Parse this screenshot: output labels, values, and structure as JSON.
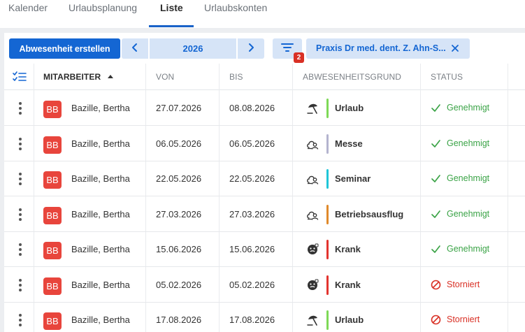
{
  "tabs": [
    {
      "label": "Kalender",
      "active": false
    },
    {
      "label": "Urlaubsplanung",
      "active": false
    },
    {
      "label": "Liste",
      "active": true
    },
    {
      "label": "Urlaubskonten",
      "active": false
    }
  ],
  "toolbar": {
    "create_label": "Abwesenheit erstellen",
    "year": "2026",
    "filter_count": "2",
    "chip_label": "Praxis Dr med. dent. Z. Ahn-S..."
  },
  "table": {
    "headers": {
      "employee": "MITARBEITER",
      "from": "VON",
      "to": "BIS",
      "reason": "ABWESENHEITSGRUND",
      "status": "STATUS"
    },
    "rows": [
      {
        "initials": "BB",
        "name": "Bazille, Bertha",
        "from": "27.07.2026",
        "to": "08.08.2026",
        "reason": "Urlaub",
        "reason_icon": "beach-umbrella-icon",
        "reason_color": "#7ed957",
        "status": "Genehmigt",
        "status_type": "approved"
      },
      {
        "initials": "BB",
        "name": "Bazille, Bertha",
        "from": "06.05.2026",
        "to": "06.05.2026",
        "reason": "Messe",
        "reason_icon": "cloud-person-icon",
        "reason_color": "#b4b4cf",
        "status": "Genehmigt",
        "status_type": "approved"
      },
      {
        "initials": "BB",
        "name": "Bazille, Bertha",
        "from": "22.05.2026",
        "to": "22.05.2026",
        "reason": "Seminar",
        "reason_icon": "cloud-person-icon",
        "reason_color": "#1fc6d8",
        "status": "Genehmigt",
        "status_type": "approved"
      },
      {
        "initials": "BB",
        "name": "Bazille, Bertha",
        "from": "27.03.2026",
        "to": "27.03.2026",
        "reason": "Betriebsausflug",
        "reason_icon": "cloud-person-icon",
        "reason_color": "#e08a2b",
        "status": "Genehmigt",
        "status_type": "approved"
      },
      {
        "initials": "BB",
        "name": "Bazille, Bertha",
        "from": "15.06.2026",
        "to": "15.06.2026",
        "reason": "Krank",
        "reason_icon": "sick-face-icon",
        "reason_color": "#e3342f",
        "status": "Genehmigt",
        "status_type": "approved"
      },
      {
        "initials": "BB",
        "name": "Bazille, Bertha",
        "from": "05.02.2026",
        "to": "05.02.2026",
        "reason": "Krank",
        "reason_icon": "sick-face-icon",
        "reason_color": "#e3342f",
        "status": "Storniert",
        "status_type": "cancelled"
      },
      {
        "initials": "BB",
        "name": "Bazille, Bertha",
        "from": "17.08.2026",
        "to": "17.08.2026",
        "reason": "Urlaub",
        "reason_icon": "beach-umbrella-icon",
        "reason_color": "#7ed957",
        "status": "Storniert",
        "status_type": "cancelled"
      }
    ]
  },
  "colors": {
    "primary": "#1466d3",
    "approved": "#3aa346",
    "cancelled": "#d93025",
    "avatar": "#e8453c"
  }
}
